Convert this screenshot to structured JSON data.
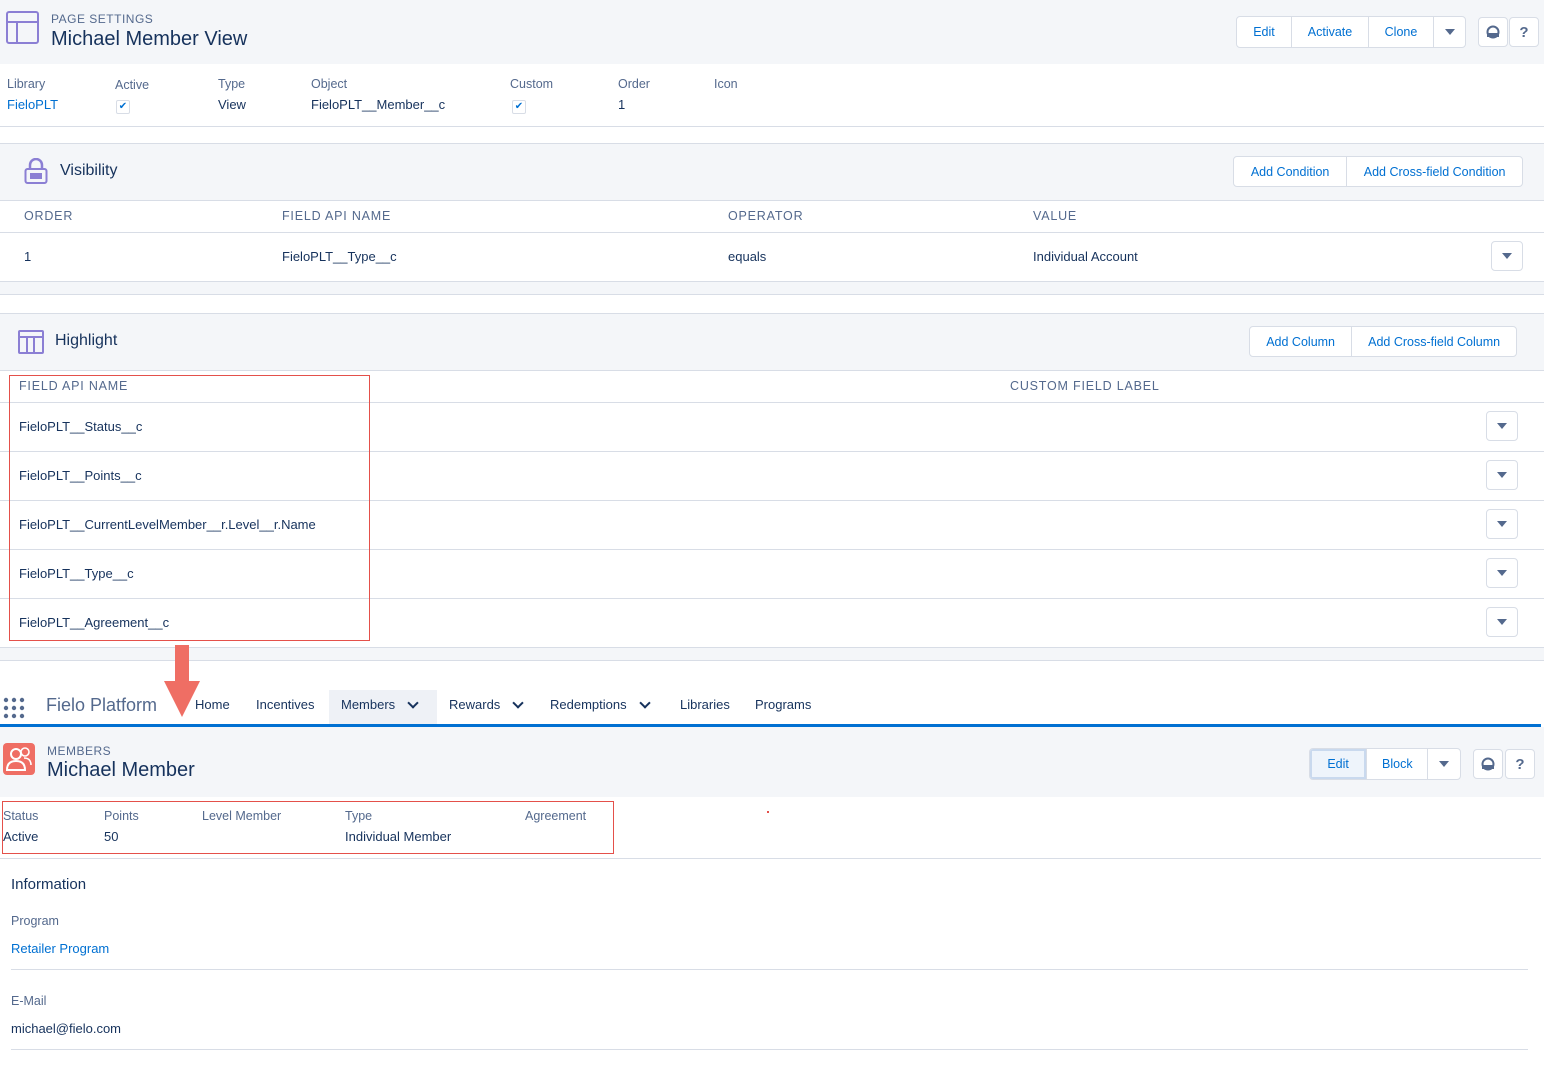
{
  "page_settings": {
    "eyebrow": "PAGE SETTINGS",
    "title": "Michael Member View",
    "buttons": {
      "edit": "Edit",
      "activate": "Activate",
      "clone": "Clone"
    },
    "icon_buttons": {
      "guide": "guide-icon",
      "help": "?"
    },
    "fields": {
      "library_label": "Library",
      "library_value": "FieloPLT",
      "active_label": "Active",
      "active_checked": true,
      "type_label": "Type",
      "type_value": "View",
      "object_label": "Object",
      "object_value": "FieloPLT__Member__c",
      "custom_label": "Custom",
      "custom_checked": true,
      "order_label": "Order",
      "order_value": "1",
      "icon_label": "Icon"
    }
  },
  "visibility": {
    "title": "Visibility",
    "buttons": {
      "add_condition": "Add Condition",
      "add_cross_field_condition": "Add Cross-field Condition"
    },
    "columns": [
      "ORDER",
      "FIELD API NAME",
      "OPERATOR",
      "VALUE"
    ],
    "rows": [
      {
        "order": "1",
        "field": "FieloPLT__Type__c",
        "operator": "equals",
        "value": "Individual Account"
      }
    ]
  },
  "highlight": {
    "title": "Highlight",
    "buttons": {
      "add_column": "Add Column",
      "add_cross_field_column": "Add Cross-field Column"
    },
    "columns": [
      "FIELD API NAME",
      "CUSTOM FIELD LABEL"
    ],
    "rows": [
      "FieloPLT__Status__c",
      "FieloPLT__Points__c",
      "FieloPLT__CurrentLevelMember__r.Level__r.Name",
      "FieloPLT__Type__c",
      "FieloPLT__Agreement__c"
    ]
  },
  "app_nav": {
    "app_name": "Fielo Platform",
    "items": [
      {
        "label": "Home",
        "has_menu": false
      },
      {
        "label": "Incentives",
        "has_menu": false
      },
      {
        "label": "Members",
        "has_menu": true,
        "active": true
      },
      {
        "label": "Rewards",
        "has_menu": true
      },
      {
        "label": "Redemptions",
        "has_menu": true
      },
      {
        "label": "Libraries",
        "has_menu": false
      },
      {
        "label": "Programs",
        "has_menu": false
      }
    ],
    "accent_color": "#0070d2"
  },
  "member_record": {
    "eyebrow": "MEMBERS",
    "title": "Michael Member",
    "buttons": {
      "edit": "Edit",
      "block": "Block"
    },
    "highlights": [
      {
        "label": "Status",
        "value": "Active"
      },
      {
        "label": "Points",
        "value": "50"
      },
      {
        "label": "Level Member",
        "value": ""
      },
      {
        "label": "Type",
        "value": "Individual Member"
      },
      {
        "label": "Agreement",
        "value": ""
      }
    ],
    "information": {
      "title": "Information",
      "program_label": "Program",
      "program_value": "Retailer Program",
      "email_label": "E-Mail",
      "email_value": "michael@fielo.com"
    }
  },
  "colors": {
    "brand_purple": "#8b7fd4",
    "member_orange": "#ef6e64",
    "annotation_red": "#e4504a",
    "link_blue": "#0070d2"
  }
}
